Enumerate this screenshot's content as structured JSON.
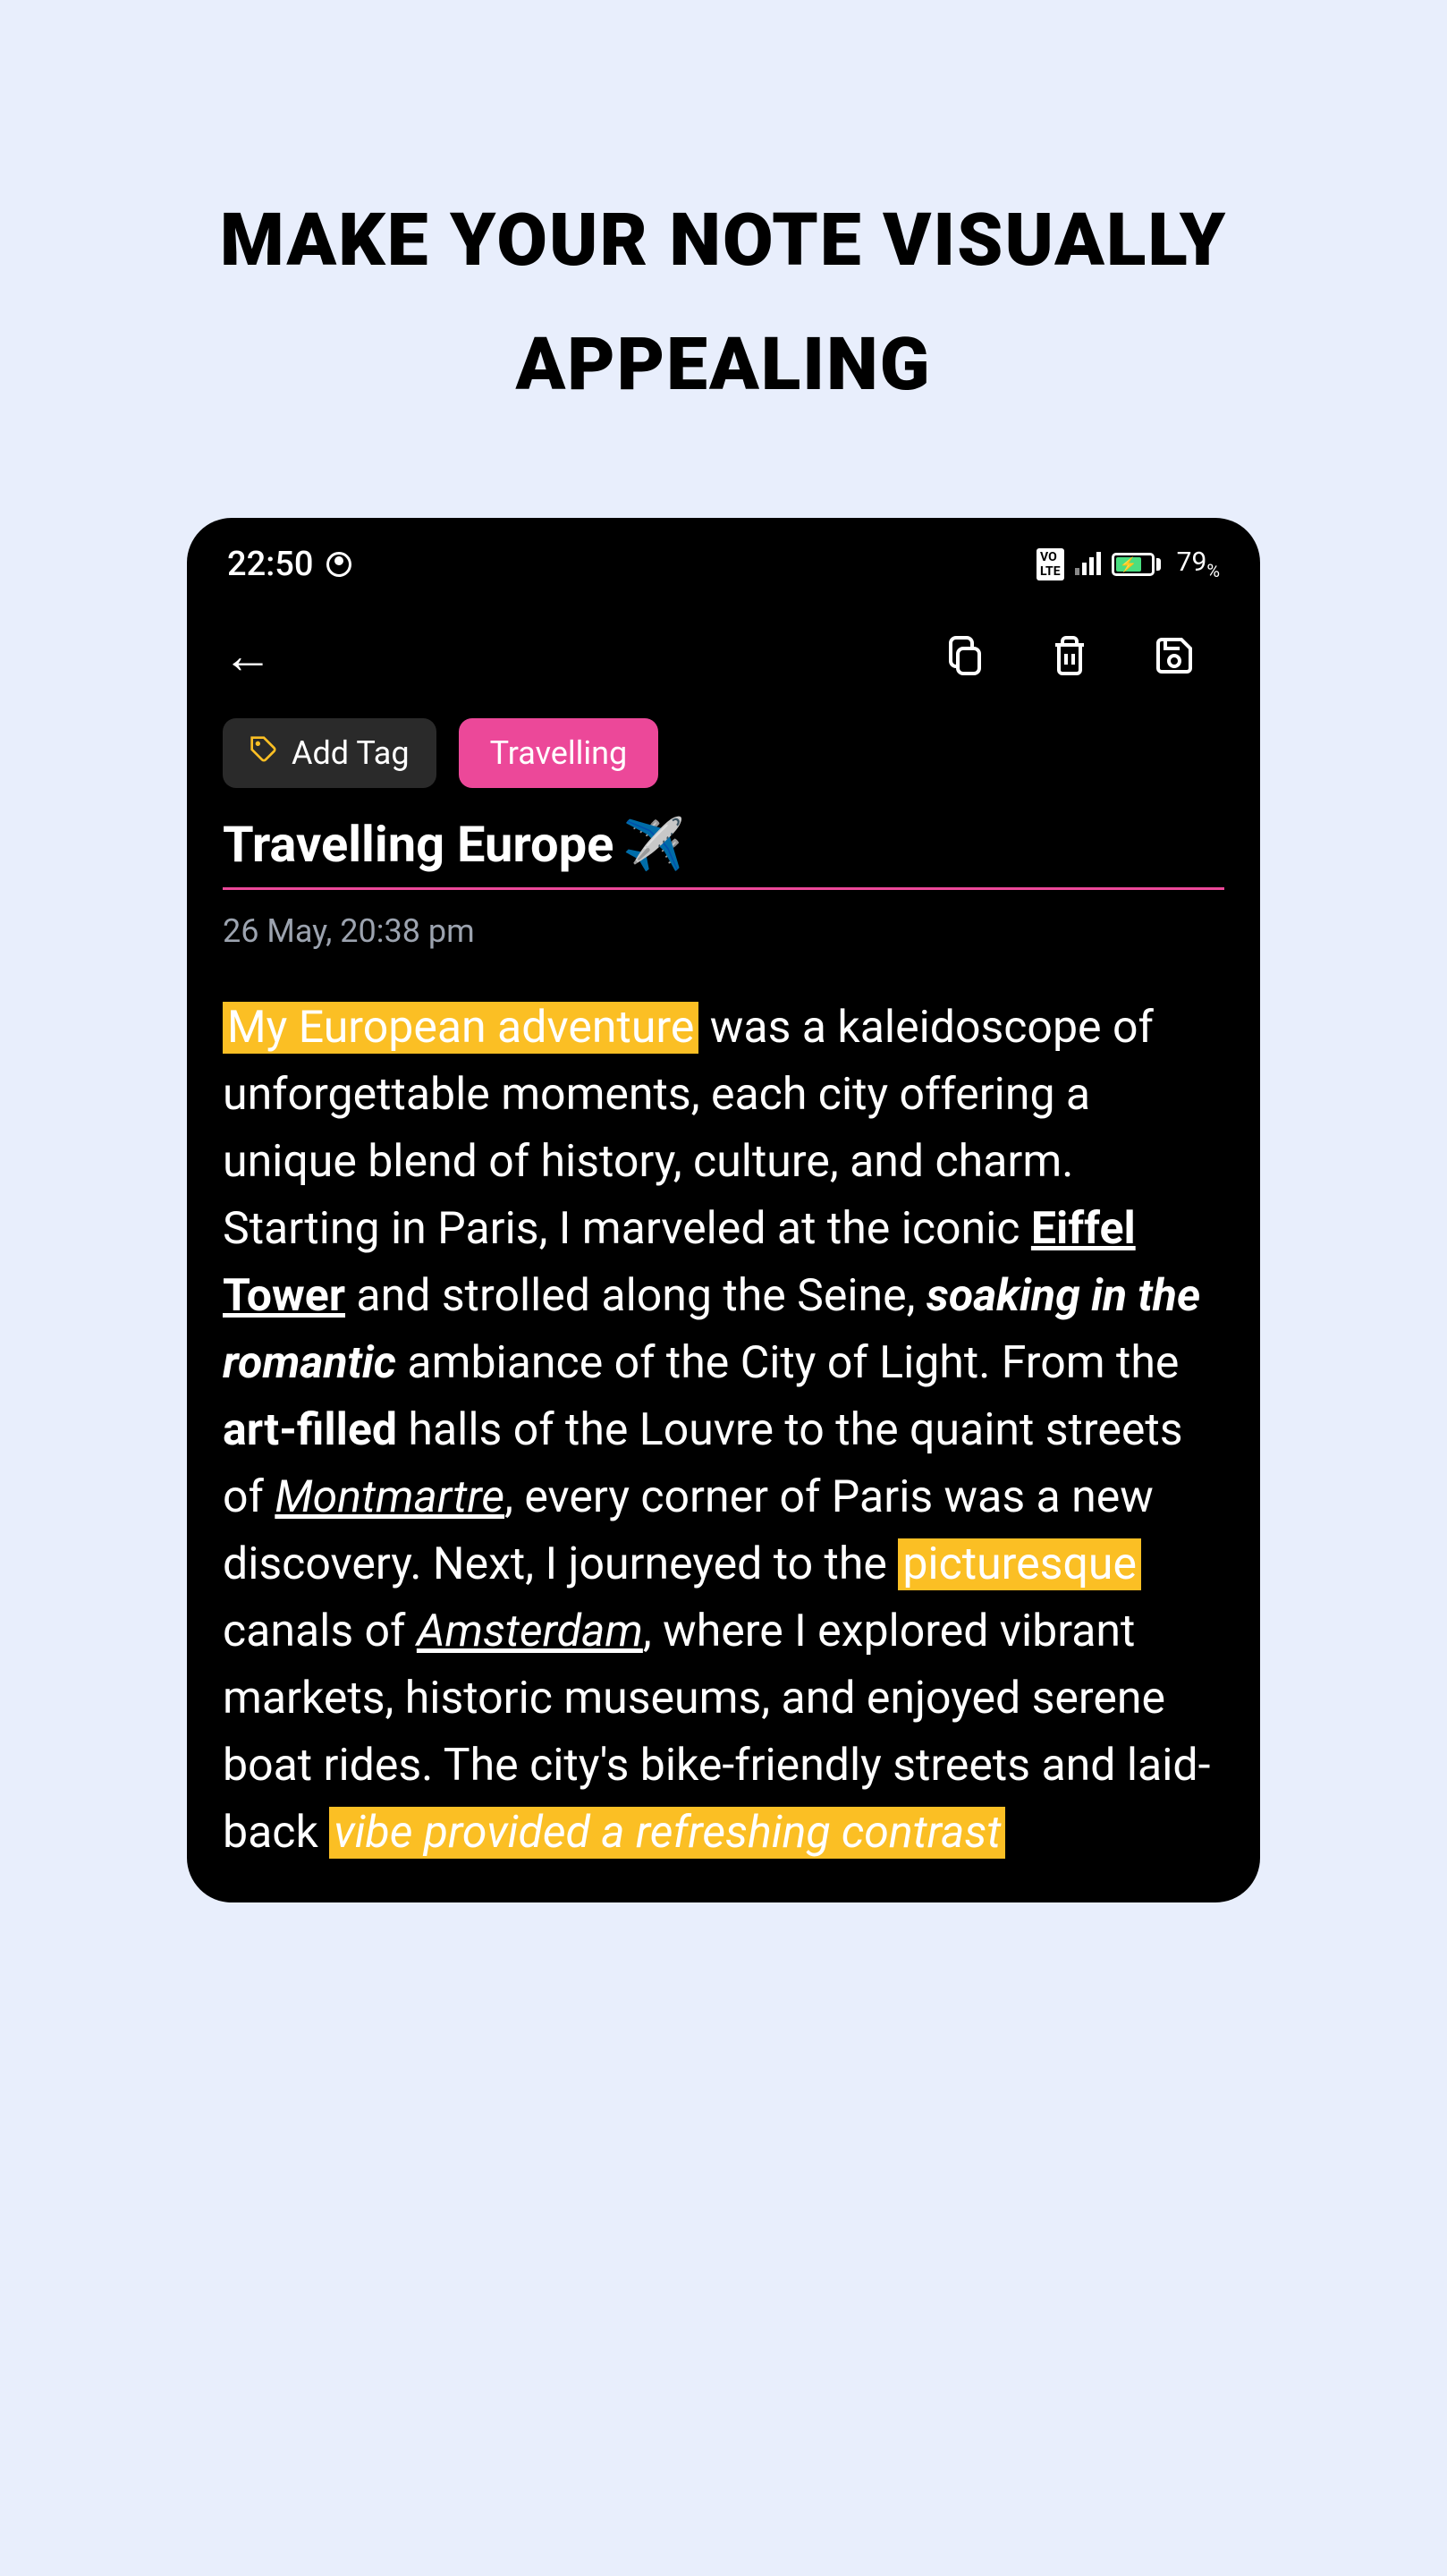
{
  "promo": {
    "headline": "MAKE YOUR NOTE VISUALLY APPEALING"
  },
  "statusBar": {
    "time": "22:50",
    "batteryPercent": "79",
    "batterySymbol": "%"
  },
  "toolbar": {
    "backLabel": "←"
  },
  "tags": {
    "addTagLabel": "Add Tag",
    "items": [
      "Travelling"
    ]
  },
  "note": {
    "title": "Travelling Europe",
    "titleEmoji": "✈️",
    "date": "26 May, 20:38 pm",
    "body": {
      "seg1_highlight": "My European adventure",
      "seg2": " was a kaleidoscope of unforgettable moments, each city offering a unique blend of history, culture, and charm. Starting in Paris, I marveled at the iconic ",
      "seg3_bold_underline": "Eiffel Tower",
      "seg4": " and strolled along the Seine, ",
      "seg5_italic_bold": "soaking in the romantic",
      "seg6": " ambiance of the City of Light. From the ",
      "seg7_bold": "art-filled",
      "seg8": " halls of the Louvre to the quaint streets of ",
      "seg9_italic_underline": "Montmartre",
      "seg10": ", every corner of Paris was a new discovery. Next, I journeyed to the ",
      "seg11_highlight": "picturesque",
      "seg12": " canals of ",
      "seg13_italic_underline": "Amsterdam",
      "seg14": ", where I explored vibrant markets, historic museums, and enjoyed serene boat rides. The city's bike-friendly streets and laid-back ",
      "seg15_italic_highlight": "vibe provided a refreshing contrast"
    }
  }
}
